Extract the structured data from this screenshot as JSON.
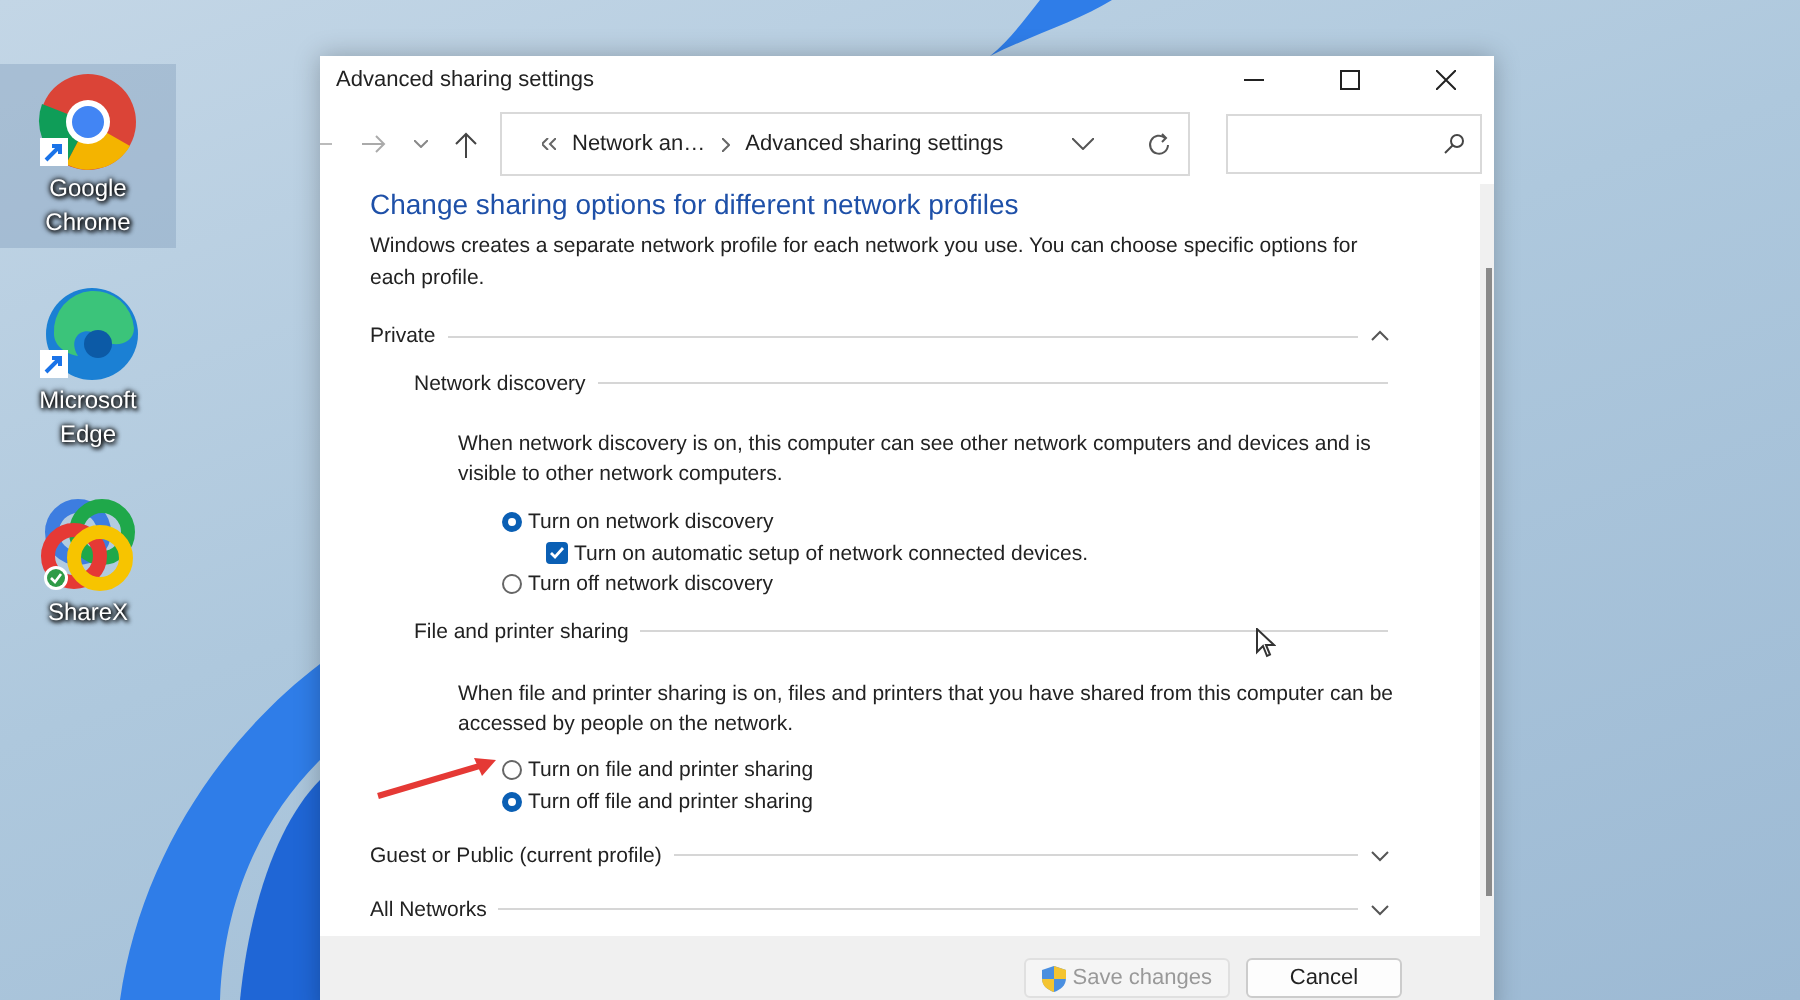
{
  "desktop_icons": [
    {
      "kind": "chrome",
      "label": "Google Chrome",
      "selected": true
    },
    {
      "kind": "edge",
      "label": "Microsoft Edge",
      "selected": false
    },
    {
      "kind": "sharex",
      "label": "ShareX",
      "selected": false
    }
  ],
  "window": {
    "title": "Advanced sharing settings",
    "breadcrumb": [
      "Network an…",
      "Advanced sharing settings"
    ]
  },
  "heading": "Change sharing options for different network profiles",
  "intro": "Windows creates a separate network profile for each network you use. You can choose specific options for each profile.",
  "profiles": [
    {
      "name": "Private",
      "expanded": true,
      "sections": [
        {
          "title": "Network discovery",
          "description": "When network discovery is on, this computer can see other network computers and devices and is visible to other network computers.",
          "options": [
            {
              "kind": "radio",
              "label": "Turn on network discovery",
              "selected": true
            },
            {
              "kind": "checkbox",
              "label": "Turn on automatic setup of network connected devices.",
              "checked": true
            },
            {
              "kind": "radio",
              "label": "Turn off network discovery",
              "selected": false
            }
          ]
        },
        {
          "title": "File and printer sharing",
          "description": "When file and printer sharing is on, files and printers that you have shared from this computer can be accessed by people on the network.",
          "options": [
            {
              "kind": "radio",
              "label": "Turn on file and printer sharing",
              "selected": false,
              "annotated": true
            },
            {
              "kind": "radio",
              "label": "Turn off file and printer sharing",
              "selected": true
            }
          ]
        }
      ]
    },
    {
      "name": "Guest or Public (current profile)",
      "expanded": false
    },
    {
      "name": "All Networks",
      "expanded": false
    }
  ],
  "footer_buttons": [
    {
      "label": "Save changes",
      "disabled": true,
      "shield": true
    },
    {
      "label": "Cancel",
      "disabled": false
    }
  ]
}
